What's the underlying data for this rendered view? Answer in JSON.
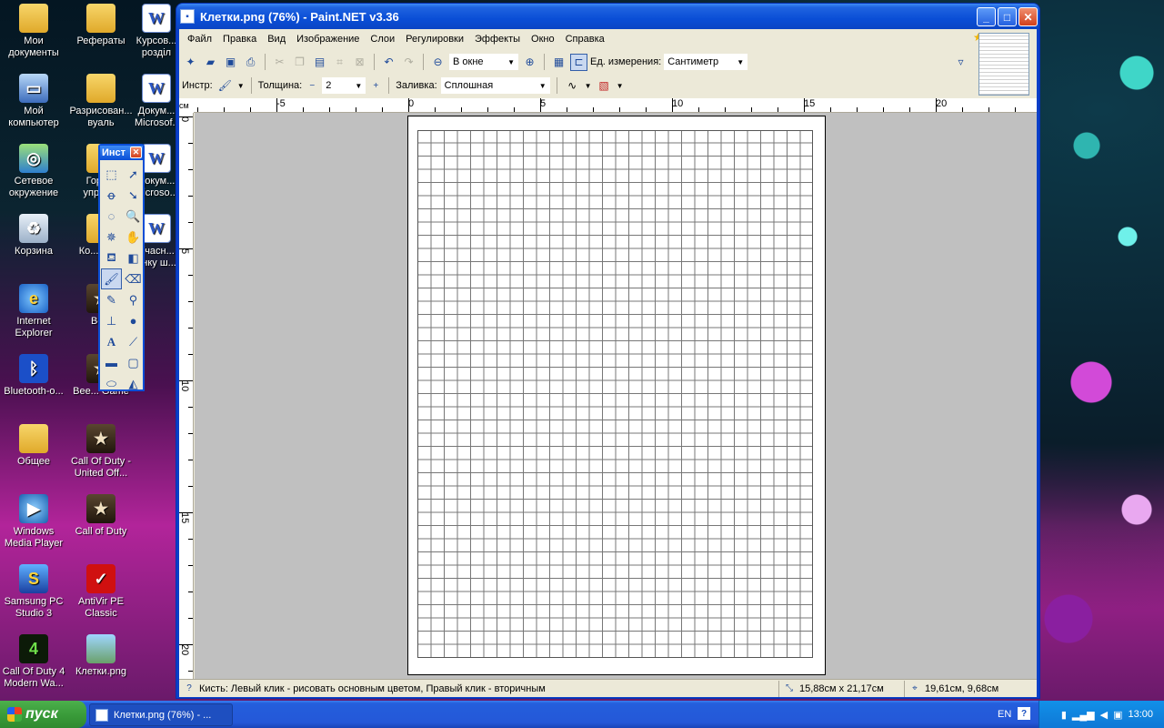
{
  "window": {
    "title": "Клетки.png (76%) - Paint.NET v3.36"
  },
  "menu": [
    "Файл",
    "Правка",
    "Вид",
    "Изображение",
    "Слои",
    "Регулировки",
    "Эффекты",
    "Окно",
    "Справка"
  ],
  "toolbar1": {
    "zoom_value": "В окне",
    "units_label": "Ед. измерения:",
    "units_value": "Сантиметр"
  },
  "toolbar2": {
    "tool_label": "Инстр:",
    "width_label": "Толщина:",
    "width_minus": "−",
    "width_value": "2",
    "width_plus": "+",
    "fill_label": "Заливка:",
    "fill_value": "Сплошная"
  },
  "ruler": {
    "unit": "см",
    "h_labels": [
      "-5",
      "0",
      "5",
      "10",
      "15",
      "20"
    ],
    "v_labels": [
      "0",
      "5",
      "10",
      "15",
      "20"
    ]
  },
  "tools_palette": {
    "title": "Инст",
    "text_tool": "A"
  },
  "status": {
    "hint": "Кисть: Левый клик - рисовать основным цветом, Правый клик - вторичным",
    "image_size": "15,88см x 21,17см",
    "cursor_pos": "19,61см, 9,68см"
  },
  "desktop": {
    "col1": [
      "Мои документы",
      "Мой компьютер",
      "Сетевое окружение",
      "Корзина",
      "Internet Explorer",
      "Bluetooth-о...",
      "Общее",
      "Windows Media Player",
      "Samsung PC Studio 3",
      "Call Of Duty 4 Modern Wa..."
    ],
    "col2": [
      "Рефераты",
      "Разрисован... вуаль",
      "Горд... упрер...",
      "Ко... tes...",
      "Вс...",
      "Bee... Game",
      "Call Of Duty - United Off...",
      "Call of Duty",
      "AntiVir PE Classic",
      "Клетки.png"
    ],
    "col3": [
      "Курсов... розділ",
      "Докум... Microsof...",
      "Докум... Microso...",
      "Учасн... инку ш..."
    ]
  },
  "taskbar": {
    "start_label": "пуск",
    "task_label": "Клетки.png (76%) - ...",
    "lang": "EN",
    "help": "?",
    "clock": "13:00"
  },
  "colors": {
    "xp_blue": "#0a4ed6",
    "start_green": "#3a9c3a",
    "workspace_gray": "#c0c0c0"
  }
}
